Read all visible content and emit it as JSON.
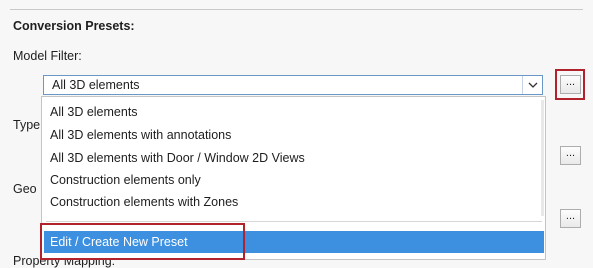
{
  "section_title": "Conversion Presets:",
  "model_filter": {
    "label": "Model Filter:",
    "selected": "All 3D elements",
    "options": [
      "All 3D elements",
      "All 3D elements with annotations",
      "All 3D elements with Door / Window 2D Views",
      "Construction elements only",
      "Construction elements with Zones"
    ],
    "edit_option": "Edit / Create New Preset"
  },
  "partial_labels": {
    "type": "Type",
    "geo": "Geo",
    "property_mapping": "Property Mapping:"
  },
  "buttons": {
    "browse": "..."
  },
  "colors": {
    "highlight_border": "#b0232d",
    "selection": "#3d8fe0"
  }
}
